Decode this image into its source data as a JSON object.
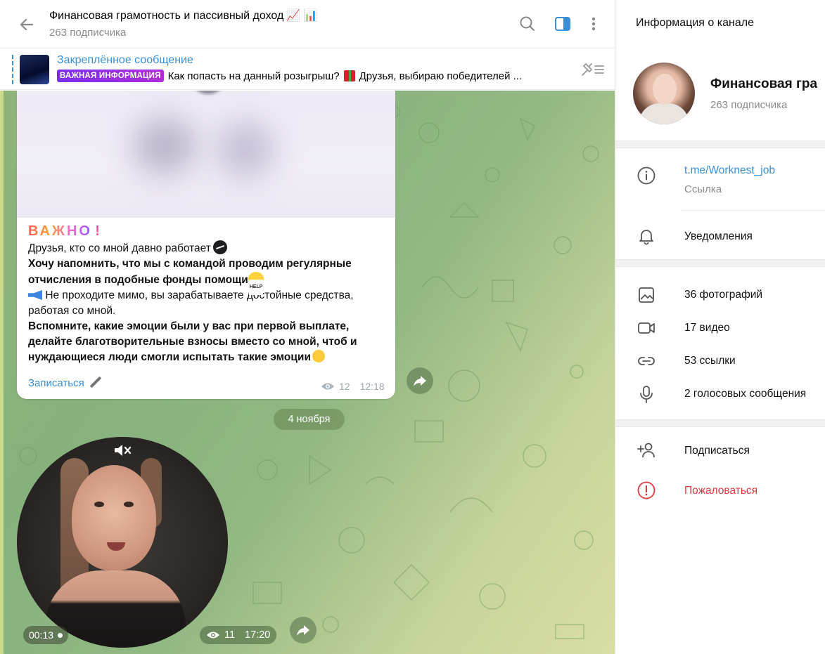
{
  "header": {
    "title": "Финансовая грамотность и пассивный доход",
    "title_emoji": "📈 📊",
    "subscribers": "263 подписчика"
  },
  "pinned": {
    "title": "Закреплённое сообщение",
    "badge": "ВАЖНАЯ ИНФОРМАЦИЯ",
    "text_part1": "Как попасть на данный розыгрыш?",
    "text_part2": "Друзья, выбираю победителей ..."
  },
  "message": {
    "heading": "ВАЖНО",
    "heading_mark": "!",
    "line1": "Друзья, кто со мной давно работает",
    "line2": "Хочу напомнить, что мы с командой проводим регулярные отчисления в подобные фонды помощи",
    "line3": "Не проходите мимо, вы зарабатываете достойные средства, работая со мной.",
    "line4": "Вспомните, какие эмоции были у вас при первой выплате, делайте благотворительные взносы вместо со мной, чтоб и нуждающиеся люди смогли испытать такие эмоции",
    "link": "Записаться",
    "views": "12",
    "time": "12:18"
  },
  "date_separator": "4 ноября",
  "video_message": {
    "duration": "00:13",
    "views": "11",
    "time": "17:20"
  },
  "info_panel": {
    "title": "Информация о канале",
    "channel_name": "Финансовая гра",
    "subscribers": "263 подписчика",
    "link_value": "t.me/Worknest_job",
    "link_label": "Ссылка",
    "notifications": "Уведомления",
    "photos": "36 фотографий",
    "videos": "17 видео",
    "links": "53 ссылки",
    "voice": "2 голосовых сообщения",
    "subscribe": "Подписаться",
    "report": "Пожаловаться"
  },
  "colors": {
    "accent": "#3a8fd4",
    "danger": "#e0393e",
    "muted": "#8a8a8a"
  },
  "icons": [
    "back-arrow-icon",
    "search-icon",
    "sidebar-toggle-icon",
    "more-vert-icon",
    "unpin-icon",
    "eye-icon",
    "forward-icon",
    "mute-icon",
    "info-icon",
    "bell-icon",
    "photo-icon",
    "video-icon",
    "link-icon",
    "mic-icon",
    "add-user-icon",
    "report-icon"
  ]
}
